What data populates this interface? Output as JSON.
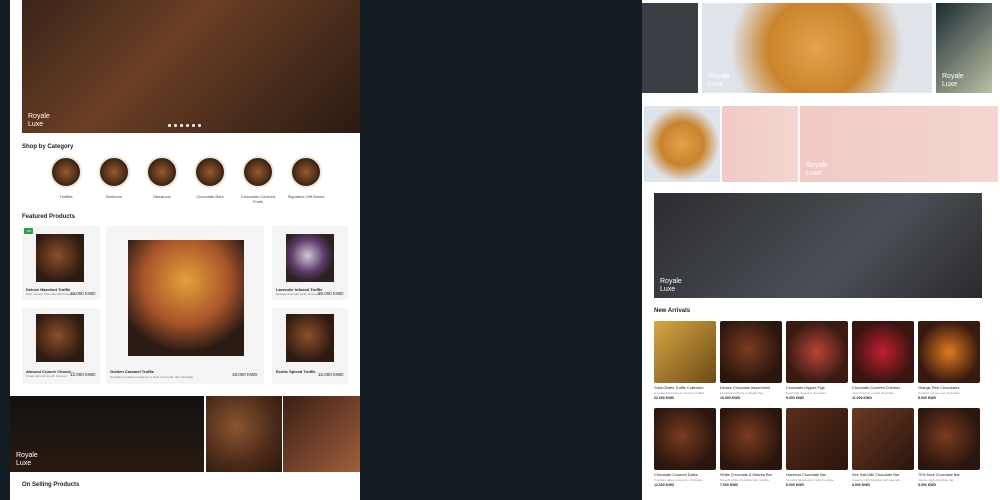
{
  "brand_logo": "Royale\nLuxe",
  "shop_by_category": {
    "title": "Shop by Category",
    "items": [
      {
        "label": "Truffles"
      },
      {
        "label": "Bonbons"
      },
      {
        "label": "Macarons"
      },
      {
        "label": "Chocolate Bars"
      },
      {
        "label": "Chocolate-Covered Fruits"
      },
      {
        "label": "Signature Gift Boxes"
      }
    ]
  },
  "featured": {
    "title": "Featured Products",
    "badge": "-5%",
    "items": [
      {
        "name": "Deluxe Hazelnut Truffle",
        "desc": "Rich, velvety chocolate filled hazelnut",
        "price": "10.000 KWD"
      },
      {
        "name": "Golden Caramel Truffle",
        "desc": "Decadent caramel encased in a shell of smooth milk chocolate",
        "price": "18.000 KWD"
      },
      {
        "name": "Lavender Infused Truffle",
        "desc": "Delicate lavender white chocolate",
        "price": "25.000 KWD"
      },
      {
        "name": "Almond Crunch Chocol...",
        "desc": "Crispy almond crunch covered",
        "price": "12.000 KWD"
      },
      {
        "name": "Exotic Spiced Truffle",
        "desc": "Warm spices dark chocolate",
        "price": "15.000 KWD"
      }
    ]
  },
  "on_selling": {
    "title": "On Selling Products"
  },
  "new_arrivals": {
    "title": "New Arrivals",
    "items": [
      {
        "name": "Gold-Gilded Truffle Collection",
        "desc": "A curated assortment of luxury truffles",
        "price": "22.000 KWD"
      },
      {
        "name": "Deluxe Chocolate Assortment",
        "desc": "Assorted bonbons in elegant box",
        "price": "16.000 KWD"
      },
      {
        "name": "Chocolate-Dipped Figs",
        "desc": "Fresh figs dipped in chocolate",
        "price": "9.000 KWD"
      },
      {
        "name": "Chocolate-Covered Cherries",
        "desc": "Juicy cherries in dark chocolate",
        "price": "11.000 KWD"
      },
      {
        "name": "Orange Peel Chocolates",
        "desc": "Candied orange peel chocolate",
        "price": "8.000 KWD"
      },
      {
        "name": "Chocolate-Covered Dates",
        "desc": "Premium dates covered in chocolate",
        "price": "12.000 KWD"
      },
      {
        "name": "White Chocolate & Matcha Bar",
        "desc": "Smooth white chocolate with matcha",
        "price": "7.000 KWD"
      },
      {
        "name": "Hazelnut Chocolate Bar",
        "desc": "Crunchy hazelnuts in milk chocolate",
        "price": "6.000 KWD"
      },
      {
        "name": "Sea Salt Milk Chocolate Bar",
        "desc": "Creamy milk chocolate with sea salt",
        "price": "6.500 KWD"
      },
      {
        "name": "70% Dark Chocolate Bar",
        "desc": "Intense dark chocolate bar",
        "price": "5.000 KWD"
      }
    ]
  }
}
